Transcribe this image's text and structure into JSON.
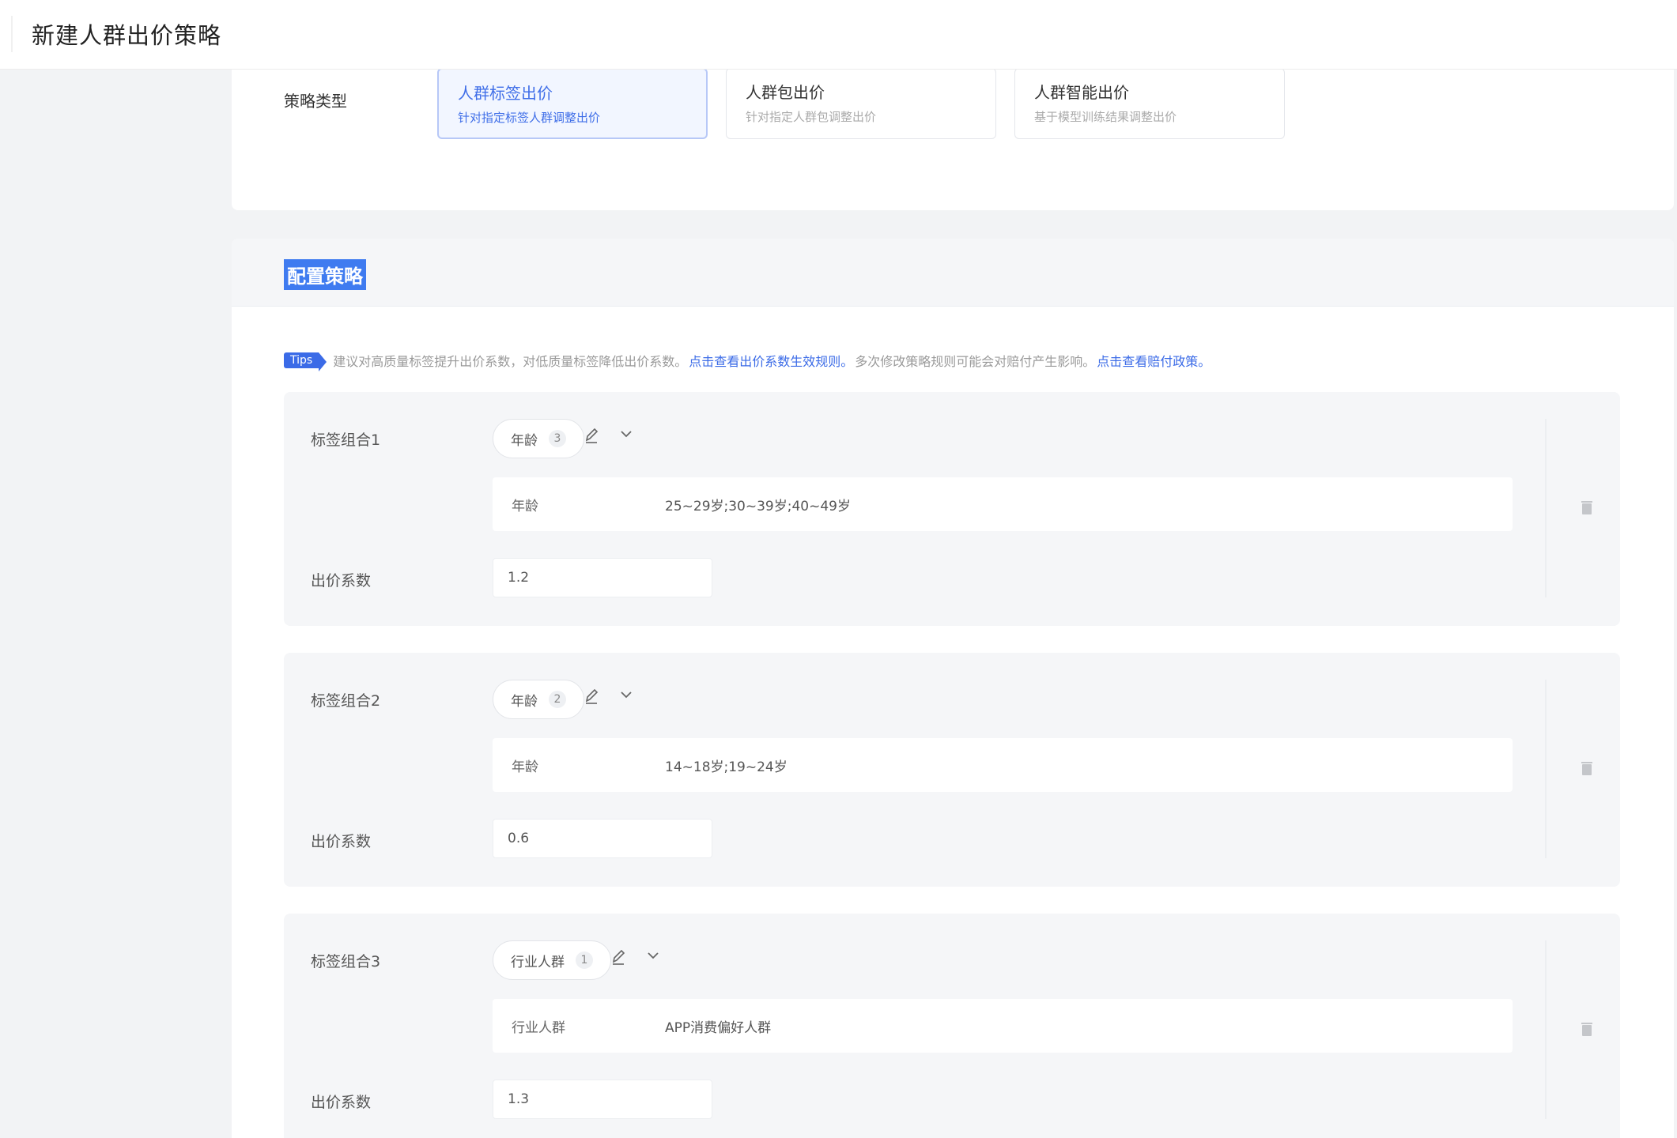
{
  "header": {
    "title": "新建人群出价策略"
  },
  "strategy_type": {
    "label": "策略类型",
    "options": [
      {
        "title": "人群标签出价",
        "desc": "针对指定标签人群调整出价",
        "selected": true
      },
      {
        "title": "人群包出价",
        "desc": "针对指定人群包调整出价",
        "selected": false
      },
      {
        "title": "人群智能出价",
        "desc": "基于模型训练结果调整出价",
        "selected": false
      }
    ]
  },
  "config": {
    "title": "配置策略",
    "tips": {
      "badge": "Tips",
      "text1": "建议对高质量标签提升出价系数，对低质量标签降低出价系数。",
      "link1": "点击查看出价系数生效规则。",
      "text2": "多次修改策略规则可能会对赔付产生影响。",
      "link2": "点击查看赔付政策。"
    },
    "groups": [
      {
        "label": "标签组合1",
        "tag": "年龄",
        "count": "3",
        "detail_key": "年龄",
        "detail_value": "25~29岁;30~39岁;40~49岁",
        "coef_label": "出价系数",
        "coef": "1.2"
      },
      {
        "label": "标签组合2",
        "tag": "年龄",
        "count": "2",
        "detail_key": "年龄",
        "detail_value": "14~18岁;19~24岁",
        "coef_label": "出价系数",
        "coef": "0.6"
      },
      {
        "label": "标签组合3",
        "tag": "行业人群",
        "count": "1",
        "detail_key": "行业人群",
        "detail_value": "APP消费偏好人群",
        "coef_label": "出价系数",
        "coef": "1.3"
      }
    ]
  },
  "icons": {
    "edit": "edit-icon",
    "expand": "chevron-down-icon",
    "delete": "trash-icon"
  },
  "colors": {
    "accent": "#3b6be7",
    "selected_border": "#b7c8f7",
    "selected_bg": "#f2f6ff"
  }
}
